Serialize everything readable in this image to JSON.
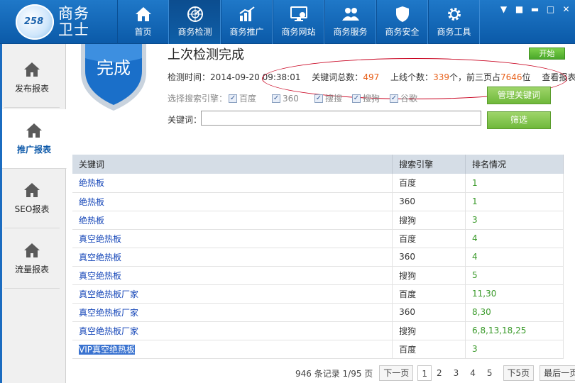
{
  "brand": {
    "logo_text": "258",
    "name": "商务卫士"
  },
  "nav": [
    {
      "label": "首页",
      "icon": "home-icon"
    },
    {
      "label": "商务检测",
      "icon": "radar-icon"
    },
    {
      "label": "商务推广",
      "icon": "chart-icon"
    },
    {
      "label": "商务网站",
      "icon": "monitor-icon"
    },
    {
      "label": "商务服务",
      "icon": "users-icon"
    },
    {
      "label": "商务安全",
      "icon": "shield-icon"
    },
    {
      "label": "商务工具",
      "icon": "gear-icon"
    }
  ],
  "window_controls": {
    "menu": "▼",
    "skin": "■",
    "minimize": "▬",
    "maximize": "□",
    "close": "✕"
  },
  "sidebar": [
    {
      "label": "发布报表",
      "icon": "house-icon"
    },
    {
      "label": "推广报表",
      "icon": "house-icon"
    },
    {
      "label": "SEO报表",
      "icon": "house-icon"
    },
    {
      "label": "流量报表",
      "icon": "house-icon"
    }
  ],
  "status": {
    "badge": "完成",
    "title": "上次检测完成",
    "start_button": "开始",
    "time_label": "检测时间：",
    "time_value": "2014-09-20 09:38:01",
    "total_label": "关键词总数：",
    "total_value": "497",
    "online_label": "上线个数：",
    "online_value": "339",
    "online_unit": "个，前三页占",
    "top3_value": "7646",
    "top3_unit": "位",
    "view_report": "查看报表"
  },
  "engines": {
    "label": "选择搜索引擎：",
    "options": [
      {
        "name": "百度",
        "checked": true
      },
      {
        "name": "360",
        "checked": true
      },
      {
        "name": "搜搜",
        "checked": true
      },
      {
        "name": "搜狗",
        "checked": true
      },
      {
        "name": "谷歌",
        "checked": true
      }
    ]
  },
  "manage_button": "管理关键词",
  "filter": {
    "label": "关键词：",
    "value": "",
    "button": "筛选"
  },
  "table": {
    "headers": [
      "关键词",
      "搜索引擎",
      "排名情况"
    ],
    "rows": [
      {
        "keyword": "绝热板",
        "engine": "百度",
        "rank": "1"
      },
      {
        "keyword": "绝热板",
        "engine": "360",
        "rank": "1"
      },
      {
        "keyword": "绝热板",
        "engine": "搜狗",
        "rank": "3"
      },
      {
        "keyword": "真空绝热板",
        "engine": "百度",
        "rank": "4"
      },
      {
        "keyword": "真空绝热板",
        "engine": "360",
        "rank": "4"
      },
      {
        "keyword": "真空绝热板",
        "engine": "搜狗",
        "rank": "5"
      },
      {
        "keyword": "真空绝热板厂家",
        "engine": "百度",
        "rank": "11,30"
      },
      {
        "keyword": "真空绝热板厂家",
        "engine": "360",
        "rank": "8,30"
      },
      {
        "keyword": "真空绝热板厂家",
        "engine": "搜狗",
        "rank": "6,8,13,18,25"
      },
      {
        "keyword": "VIP真空绝热板",
        "engine": "百度",
        "rank": "3"
      }
    ]
  },
  "pager": {
    "summary": "946 条记录 1/95 页",
    "next": "下一页",
    "pages": [
      "1",
      "2",
      "3",
      "4",
      "5"
    ],
    "next5": "下5页",
    "last": "最后一页"
  }
}
